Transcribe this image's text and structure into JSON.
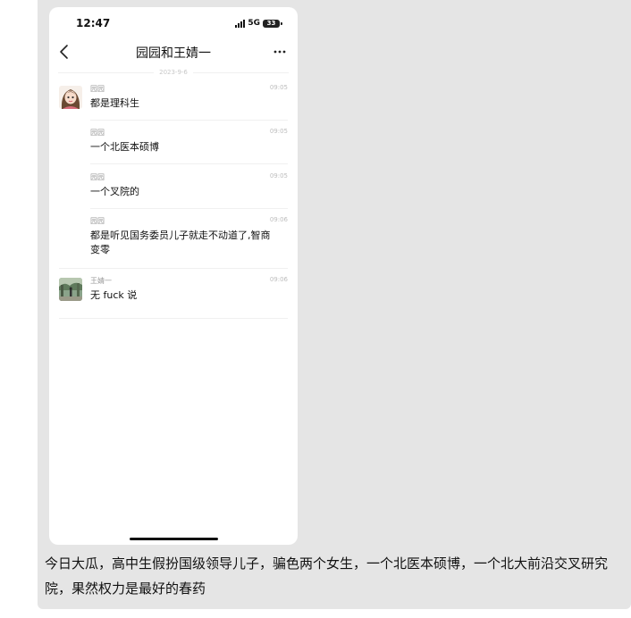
{
  "status_bar": {
    "time": "12:47",
    "network": "5G",
    "battery": "33"
  },
  "nav": {
    "title": "园园和王婧一"
  },
  "date_separator": "2023-9-6",
  "messages": [
    {
      "sender": "园园",
      "time": "09:05",
      "text": "都是理科生"
    },
    {
      "sender": "园园",
      "time": "09:05",
      "text": "一个北医本硕博"
    },
    {
      "sender": "园园",
      "time": "09:05",
      "text": "一个叉院的"
    },
    {
      "sender": "园园",
      "time": "09:06",
      "text": "都是听见国务委员儿子就走不动道了,智商变零"
    },
    {
      "sender": "王婧一",
      "time": "09:06",
      "text": "无 fuck 说"
    }
  ],
  "caption": "今日大瓜，高中生假扮国级领导儿子，骗色两个女生，一个北医本硕博，一个北大前沿交叉研究院，果然权力是最好的春药"
}
